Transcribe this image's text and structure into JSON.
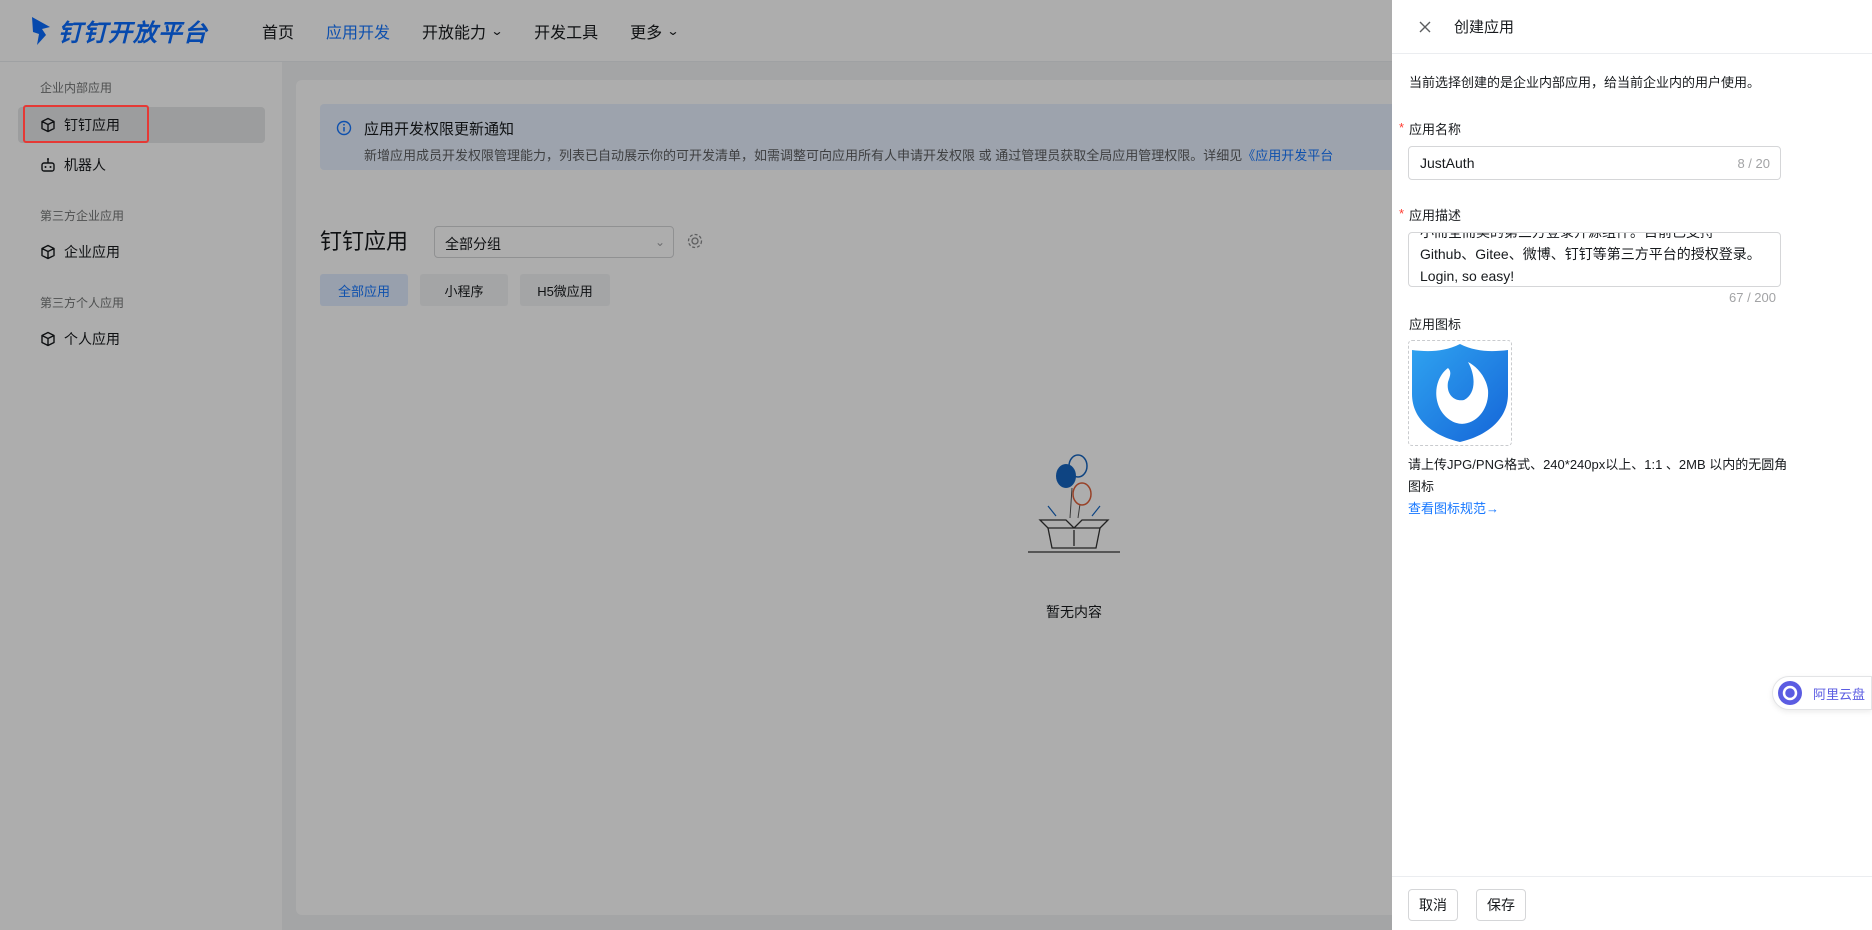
{
  "topnav": {
    "logo_text": "钉钉开放平台",
    "items": [
      {
        "label": "首页",
        "active": false,
        "has_dropdown": false
      },
      {
        "label": "应用开发",
        "active": true,
        "has_dropdown": false
      },
      {
        "label": "开放能力",
        "active": false,
        "has_dropdown": true
      },
      {
        "label": "开发工具",
        "active": false,
        "has_dropdown": false
      },
      {
        "label": "更多",
        "active": false,
        "has_dropdown": true
      }
    ]
  },
  "sidebar": {
    "groups": [
      {
        "title": "企业内部应用",
        "items": [
          {
            "label": "钉钉应用",
            "icon": "cube-icon",
            "active": true
          },
          {
            "label": "机器人",
            "icon": "robot-icon",
            "active": false
          }
        ]
      },
      {
        "title": "第三方企业应用",
        "items": [
          {
            "label": "企业应用",
            "icon": "cube-icon",
            "active": false
          }
        ]
      },
      {
        "title": "第三方个人应用",
        "items": [
          {
            "label": "个人应用",
            "icon": "cube-icon",
            "active": false
          }
        ]
      }
    ]
  },
  "notice": {
    "title": "应用开发权限更新通知",
    "body": "新增应用成员开发权限管理能力，列表已自动展示你的可开发清单，如需调整可向应用所有人申请开发权限 或 通过管理员获取全局应用管理权限。详细见",
    "link": "《应用开发平台"
  },
  "apps": {
    "title": "钉钉应用",
    "group_select": "全部分组",
    "tabs": [
      "全部应用",
      "小程序",
      "H5微应用"
    ],
    "active_tab": 0,
    "empty_text": "暂无内容"
  },
  "drawer": {
    "title": "创建应用",
    "intro": "当前选择创建的是企业内部应用，给当前企业内的用户使用。",
    "name_label": "应用名称",
    "name_value": "JustAuth",
    "name_count": "8 / 20",
    "desc_label": "应用描述",
    "desc_lines": [
      "小而全而美的第三方登录开源组件。目前已支持",
      "Github、Gitee、微博、钉钉等第三方平台的授权登录。",
      "Login, so easy!"
    ],
    "desc_count": "67 / 200",
    "icon_label": "应用图标",
    "icon_hint": "请上传JPG/PNG格式、240*240px以上、1:1 、2MB 以内的无圆角图标",
    "spec_link": "查看图标规范→",
    "cancel": "取消",
    "save": "保存"
  },
  "float_widget": {
    "label": "阿里云盘"
  },
  "colors": {
    "accent": "#1677ff",
    "required": "#ff3b30",
    "highlight": "#e53935",
    "logo": "#0a6cff"
  }
}
